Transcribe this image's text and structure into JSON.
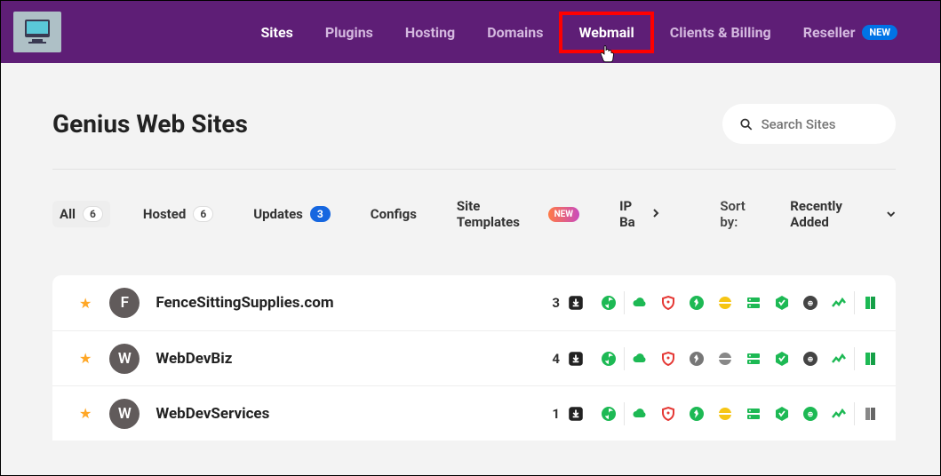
{
  "nav": {
    "items": [
      "Sites",
      "Plugins",
      "Hosting",
      "Domains",
      "Webmail",
      "Clients & Billing",
      "Reseller"
    ],
    "new_label": "NEW",
    "active_index": 0,
    "highlight_index": 4
  },
  "page": {
    "title": "Genius Web Sites"
  },
  "search": {
    "placeholder": "Search Sites"
  },
  "filters": {
    "tabs": [
      {
        "label": "All",
        "count": "6"
      },
      {
        "label": "Hosted",
        "count": "6"
      },
      {
        "label": "Updates",
        "count": "3"
      },
      {
        "label": "Configs"
      },
      {
        "label": "Site Templates",
        "pill": "NEW"
      },
      {
        "label": "IP Ba"
      }
    ],
    "sort_label": "Sort by:",
    "sort_value": "Recently Added"
  },
  "sites": [
    {
      "initial": "F",
      "name": "FenceSittingSupplies.com",
      "updates": "3",
      "icon_variants": {
        "speed": "green",
        "disc": "yellow",
        "perf": "grey",
        "book": "green"
      }
    },
    {
      "initial": "W",
      "name": "WebDevBiz",
      "updates": "4",
      "icon_variants": {
        "speed": "grey",
        "disc": "grey",
        "perf": "grey",
        "book": "green"
      }
    },
    {
      "initial": "W",
      "name": "WebDevServices",
      "updates": "1",
      "icon_variants": {
        "speed": "green",
        "disc": "yellow",
        "perf": "green",
        "book": "grey"
      }
    }
  ],
  "colors": {
    "green": "#1db954",
    "red": "#e53935",
    "grey": "#333",
    "grey2": "#777",
    "yellow": "#f6c514"
  }
}
